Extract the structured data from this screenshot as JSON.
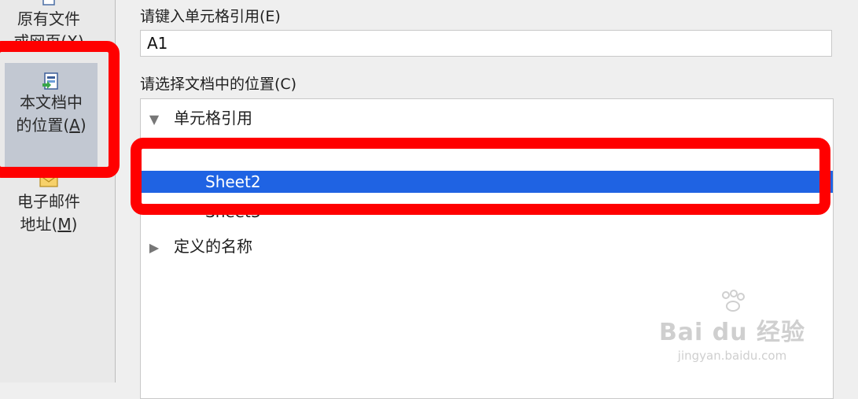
{
  "sidebar": {
    "items": [
      {
        "label_line1": "原有文件",
        "label_line2": "或网页(X)"
      },
      {
        "label_line1": "本文档中",
        "label_line2": "的位置(",
        "hotkey": "A",
        "label_close": ")"
      },
      {
        "label_line1": "电子邮件",
        "label_line2": "地址(",
        "hotkey": "M",
        "label_close": ")"
      }
    ]
  },
  "main": {
    "ref_label": "请键入单元格引用(E)",
    "ref_value": "A1",
    "place_label": "请选择文档中的位置(C)",
    "tree": {
      "cell_ref_label": "单元格引用",
      "selected_sheet": "Sheet2",
      "next_sheet": "Sheet3",
      "defined_names_label": "定义的名称"
    }
  },
  "watermark": {
    "brand": "Bai du 经验",
    "url": "jingyan.baidu.com"
  },
  "colors": {
    "highlight": "#ff0000",
    "selection": "#1f63e3",
    "active_sidebar": "#c2c8d2"
  }
}
